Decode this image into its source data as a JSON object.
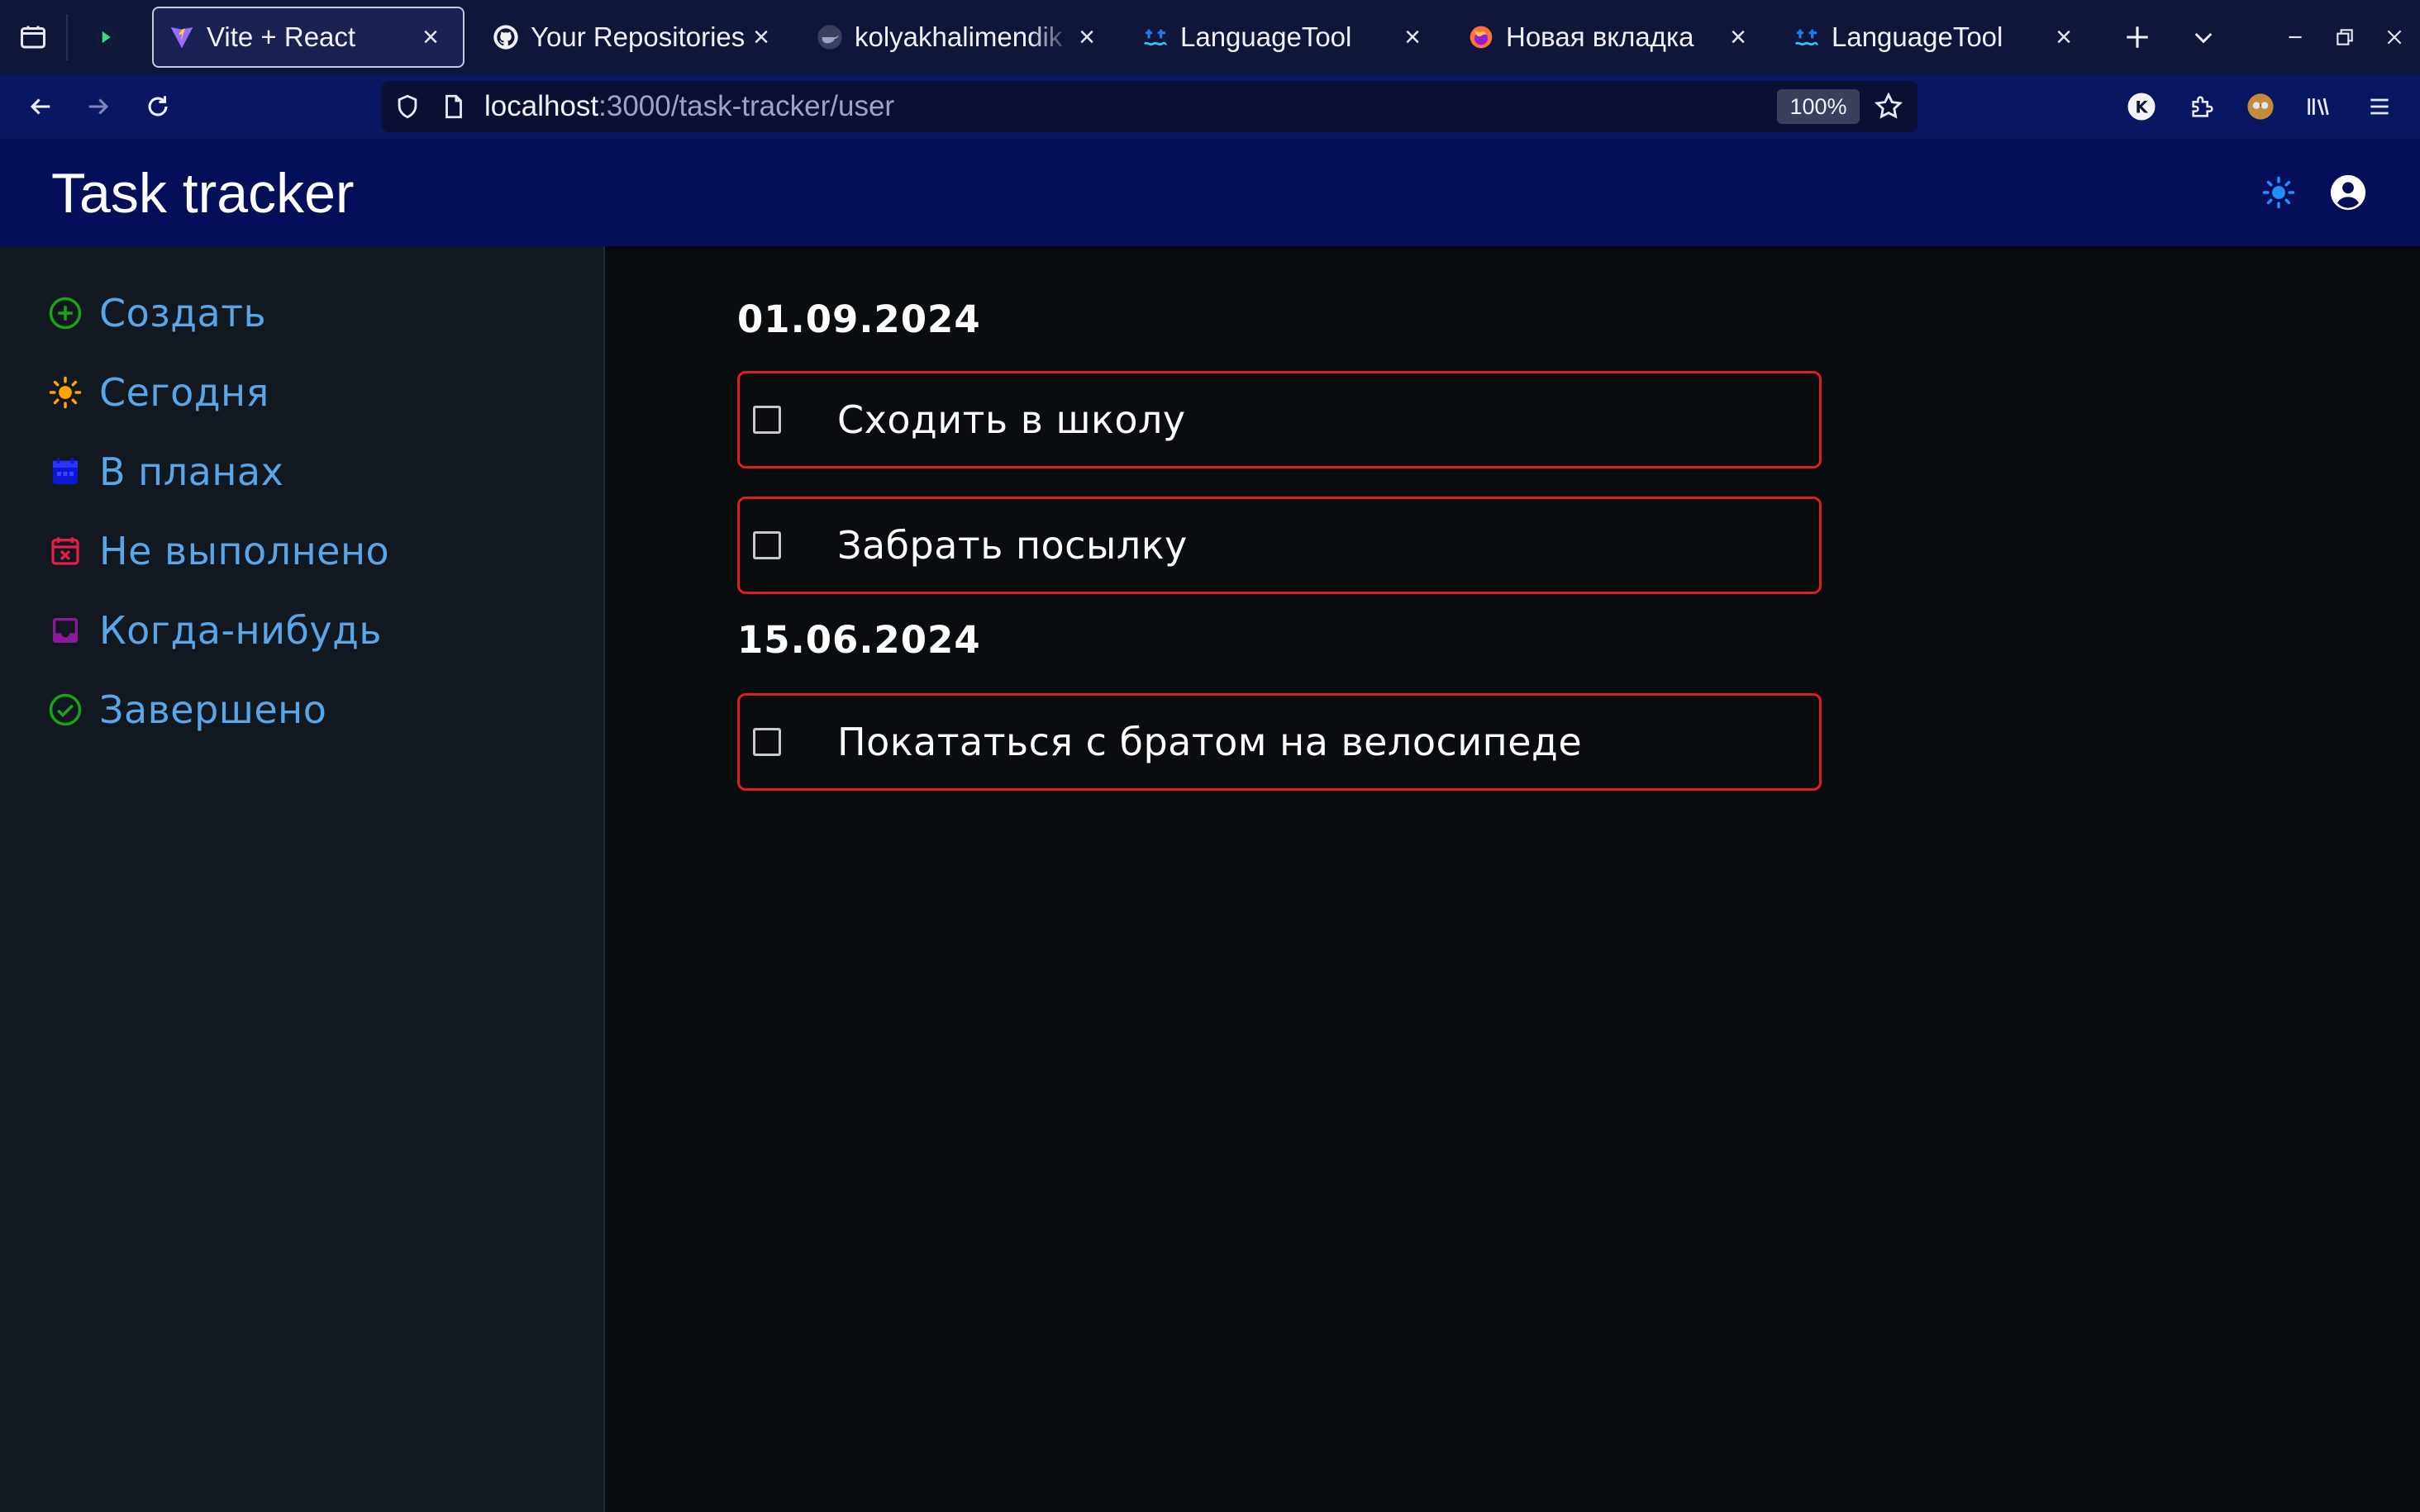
{
  "browser": {
    "tabs": [
      {
        "title": "Vite + React",
        "icon": "vite-icon",
        "active": true
      },
      {
        "title": "Your Repositories",
        "icon": "github-icon"
      },
      {
        "title": "kolyakhalimendik",
        "icon": "docker-icon"
      },
      {
        "title": "LanguageTool",
        "icon": "languagetool-icon"
      },
      {
        "title": "Новая вкладка",
        "icon": "firefox-icon"
      },
      {
        "title": "LanguageTool",
        "icon": "languagetool-icon"
      }
    ],
    "url_host": "localhost",
    "url_path": ":3000/task-tracker/user",
    "zoom": "100%",
    "extension_badge": "K"
  },
  "app": {
    "title": "Task tracker"
  },
  "sidebar": {
    "items": [
      {
        "label": "Создать",
        "icon": "add-circle-icon",
        "color": "#1aa21a"
      },
      {
        "label": "Сегодня",
        "icon": "sun-icon",
        "color": "#ffa500"
      },
      {
        "label": "В планах",
        "icon": "calendar-icon",
        "color": "#0f17d6"
      },
      {
        "label": "Не выполнено",
        "icon": "calendar-x-icon",
        "color": "#e11d48"
      },
      {
        "label": "Когда-нибудь",
        "icon": "inbox-icon",
        "color": "#8b1a9a"
      },
      {
        "label": "Завершено",
        "icon": "check-circle-icon",
        "color": "#1aa21a"
      }
    ]
  },
  "tasks": {
    "groups": [
      {
        "date": "01.09.2024",
        "items": [
          {
            "text": "Сходить в школу",
            "done": false
          },
          {
            "text": "Забрать посылку",
            "done": false
          }
        ]
      },
      {
        "date": "15.06.2024",
        "items": [
          {
            "text": "Покататься с братом на велосипеде",
            "done": false
          }
        ]
      }
    ]
  },
  "colors": {
    "accent_link": "#58a6e8",
    "task_border": "#e01d1d",
    "header_bg": "#040e59",
    "sidebar_bg": "#121820",
    "main_bg": "#090d10"
  }
}
